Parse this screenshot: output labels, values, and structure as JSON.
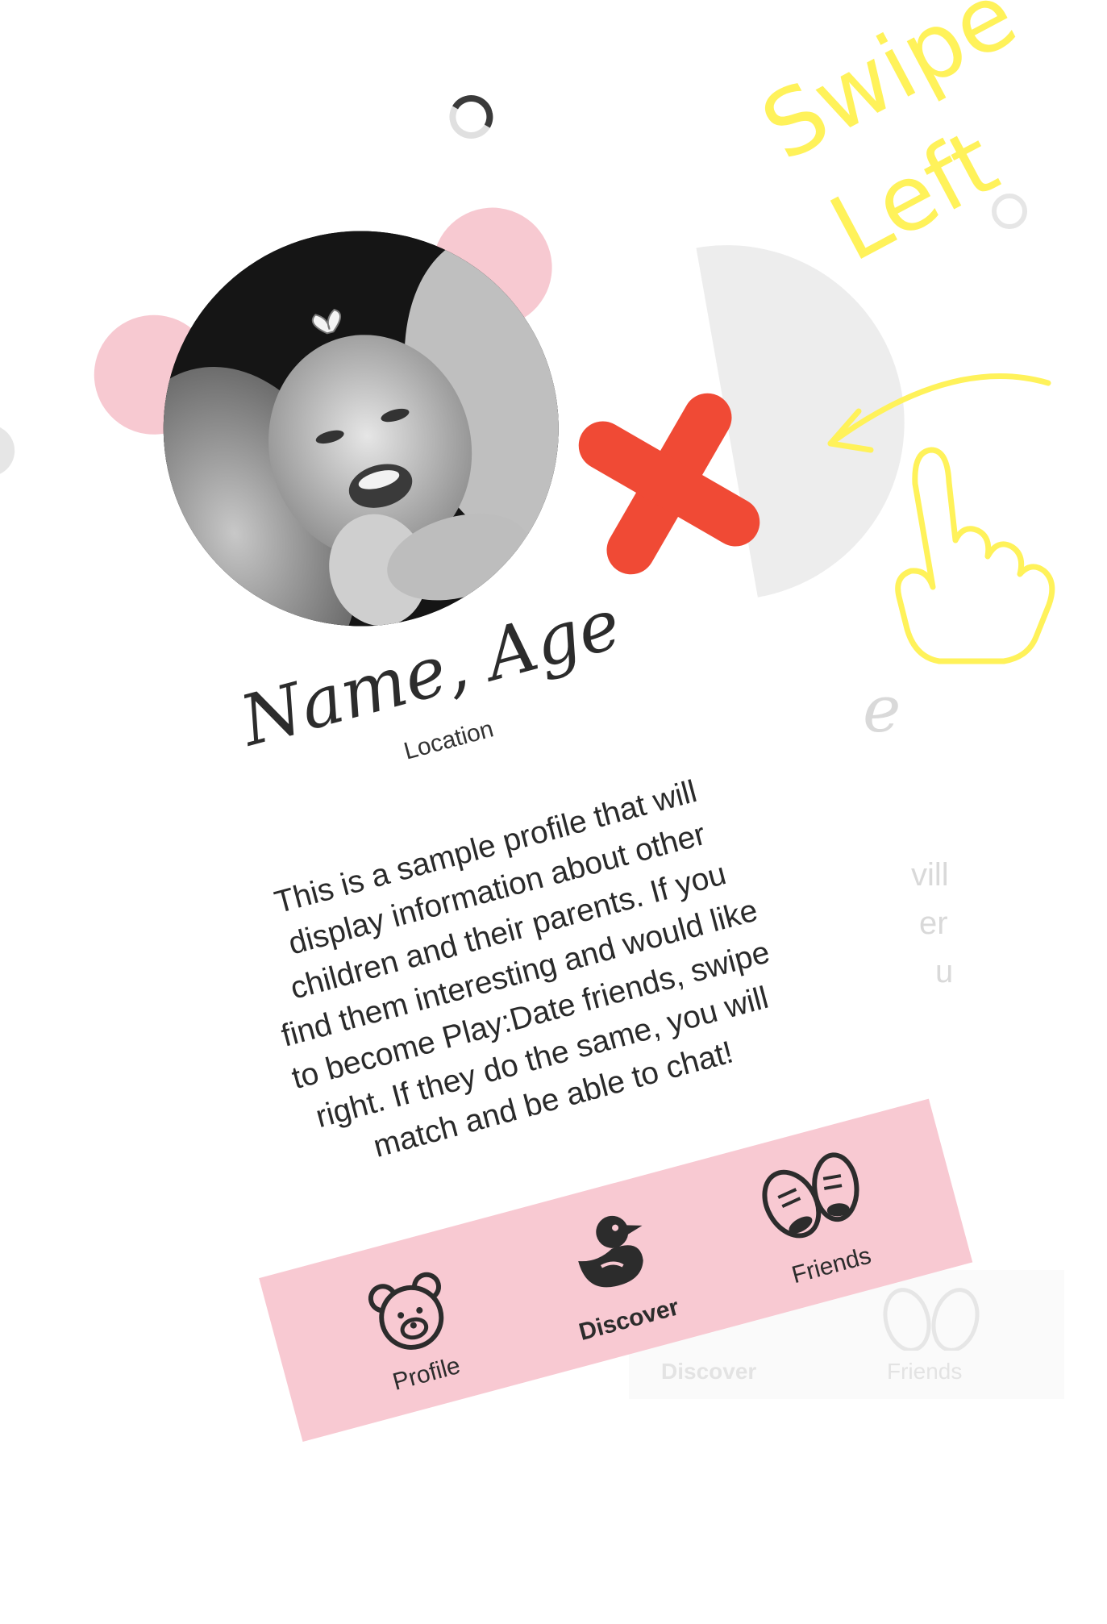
{
  "card": {
    "name_age": "Name, Age",
    "location": "Location",
    "bio": "This is a sample profile that will display information about other children and their parents. If you find them interesting and would like to become Play:Date friends, swipe right. If they do the same, you will match and be able to chat!"
  },
  "nav": {
    "items": [
      {
        "label": "Profile",
        "icon": "teddy-bear-icon",
        "active": false
      },
      {
        "label": "Discover",
        "icon": "duck-icon",
        "active": true
      },
      {
        "label": "Friends",
        "icon": "baby-shoes-icon",
        "active": false
      }
    ]
  },
  "ghost_card": {
    "name_fragment": "e",
    "bio_fragments": [
      "vill",
      "er",
      "u"
    ],
    "nav_discover": "Discover",
    "nav_friends": "Friends"
  },
  "annotation": {
    "line1": "Swipe",
    "line2": "Left"
  },
  "colors": {
    "accent_pink": "#f8c9d2",
    "ear_pink": "#f7c9d1",
    "dislike_red": "#f04a35",
    "annotation_yellow": "#fff25a"
  },
  "icons": {
    "report": "flag-icon",
    "loading": "spinner-icon",
    "dislike": "x-mark-icon",
    "gesture": "pointing-hand-icon"
  }
}
